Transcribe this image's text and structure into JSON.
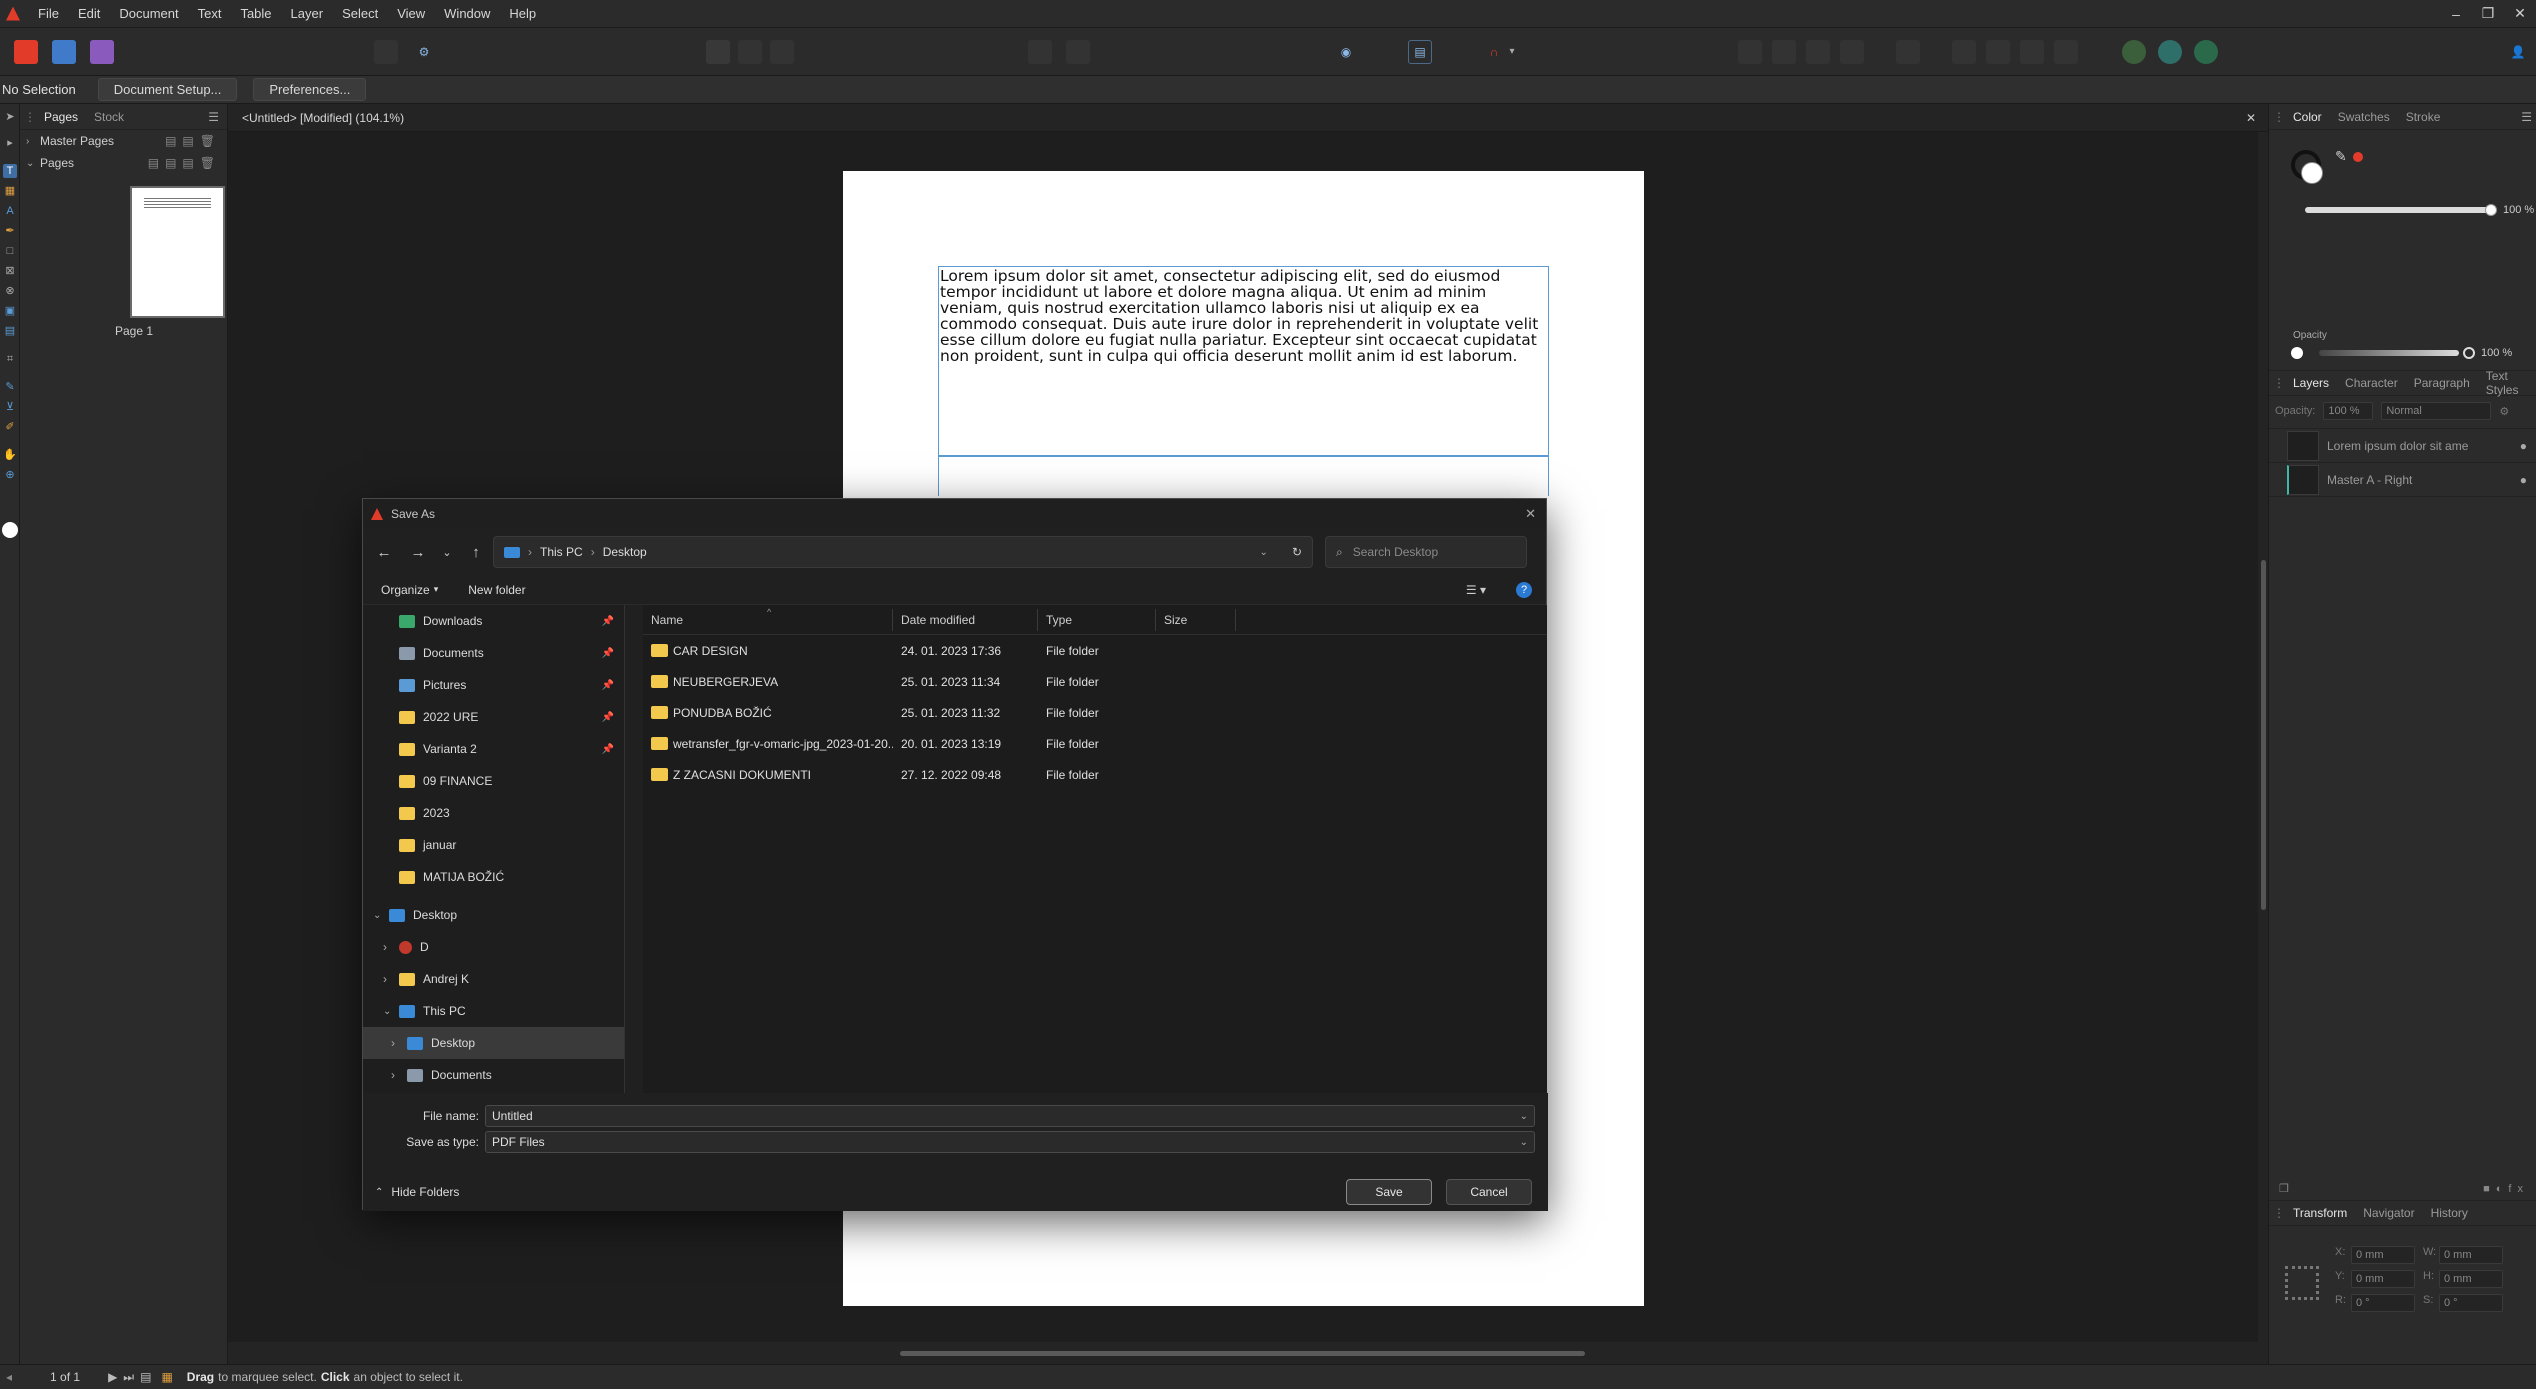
{
  "menubar": {
    "items": [
      "File",
      "Edit",
      "Document",
      "Text",
      "Table",
      "Layer",
      "Select",
      "View",
      "Window",
      "Help"
    ]
  },
  "context_bar": {
    "selection": "No Selection",
    "document_setup": "Document Setup...",
    "preferences": "Preferences..."
  },
  "pages_panel": {
    "tabs": [
      "Pages",
      "Stock"
    ],
    "master_pages": "Master Pages",
    "pages": "Pages",
    "page_label": "Page 1"
  },
  "document": {
    "tab_title": "<Untitled> [Modified] (104.1%)",
    "lorem": "Lorem ipsum dolor sit amet, consectetur adipiscing elit, sed do eiusmod tempor incididunt ut labore et dolore magna aliqua. Ut enim ad minim veniam, quis nostrud exercitation ullamco laboris nisi ut aliquip ex ea commodo consequat. Duis aute irure dolor in reprehenderit in voluptate velit esse cillum dolore eu fugiat nulla pariatur. Excepteur sint occaecat cupidatat non proident, sunt in culpa qui officia deserunt mollit anim id est laborum."
  },
  "status_bar": {
    "page_count": "1 of 1",
    "hint_drag": "Drag",
    "hint_mid": "to marquee select.",
    "hint_click": "Click",
    "hint_end": "an object to select it."
  },
  "color_panel": {
    "tabs": [
      "Color",
      "Swatches",
      "Stroke"
    ],
    "tint_value": "100 %",
    "opacity_label": "Opacity",
    "opacity_value": "100 %",
    "accent": "#e23b2a"
  },
  "layers_panel": {
    "tabs": [
      "Layers",
      "Character",
      "Paragraph",
      "Text Styles"
    ],
    "opacity_label": "Opacity:",
    "opacity_value": "100 %",
    "blend_mode": "Normal",
    "layers": [
      "Lorem ipsum dolor sit ame",
      "Master A - Right"
    ]
  },
  "transform_panel": {
    "tabs": [
      "Transform",
      "Navigator",
      "History"
    ],
    "x_label": "X:",
    "x": "0 mm",
    "y_label": "Y:",
    "y": "0 mm",
    "w_label": "W:",
    "w": "0 mm",
    "h_label": "H:",
    "h": "0 mm",
    "r_label": "R:",
    "r": "0 °",
    "s_label": "S:",
    "s": "0 °"
  },
  "dialog": {
    "title": "Save As",
    "path": [
      "This PC",
      "Desktop"
    ],
    "search_placeholder": "Search Desktop",
    "organize": "Organize",
    "new_folder": "New folder",
    "nav_items": [
      {
        "label": "Downloads",
        "pinned": true
      },
      {
        "label": "Documents",
        "pinned": true
      },
      {
        "label": "Pictures",
        "pinned": true
      },
      {
        "label": "2022 URE",
        "pinned": true
      },
      {
        "label": "Varianta 2",
        "pinned": true
      },
      {
        "label": "09 FINANCE",
        "pinned": false
      },
      {
        "label": "2023",
        "pinned": false
      },
      {
        "label": "januar",
        "pinned": false
      },
      {
        "label": "MATIJA BOŽIĆ",
        "pinned": false
      }
    ],
    "tree": [
      "Desktop",
      "D",
      "Andrej K",
      "This PC",
      "Desktop",
      "Documents"
    ],
    "columns": [
      "Name",
      "Date modified",
      "Type",
      "Size"
    ],
    "files": [
      {
        "name": "CAR DESIGN",
        "date": "24. 01. 2023 17:36",
        "type": "File folder"
      },
      {
        "name": "NEUBERGERJEVA",
        "date": "25. 01. 2023 11:34",
        "type": "File folder"
      },
      {
        "name": "PONUDBA BOŽIĆ",
        "date": "25. 01. 2023 11:32",
        "type": "File folder"
      },
      {
        "name": "wetransfer_fgr-v-omaric-jpg_2023-01-20...",
        "date": "20. 01. 2023 13:19",
        "type": "File folder"
      },
      {
        "name": "Z ZACASNI DOKUMENTI",
        "date": "27. 12. 2022 09:48",
        "type": "File folder"
      }
    ],
    "file_name_label": "File name:",
    "file_name": "Untitled",
    "save_type_label": "Save as type:",
    "save_type": "PDF Files",
    "hide_folders": "Hide Folders",
    "save": "Save",
    "cancel": "Cancel"
  }
}
